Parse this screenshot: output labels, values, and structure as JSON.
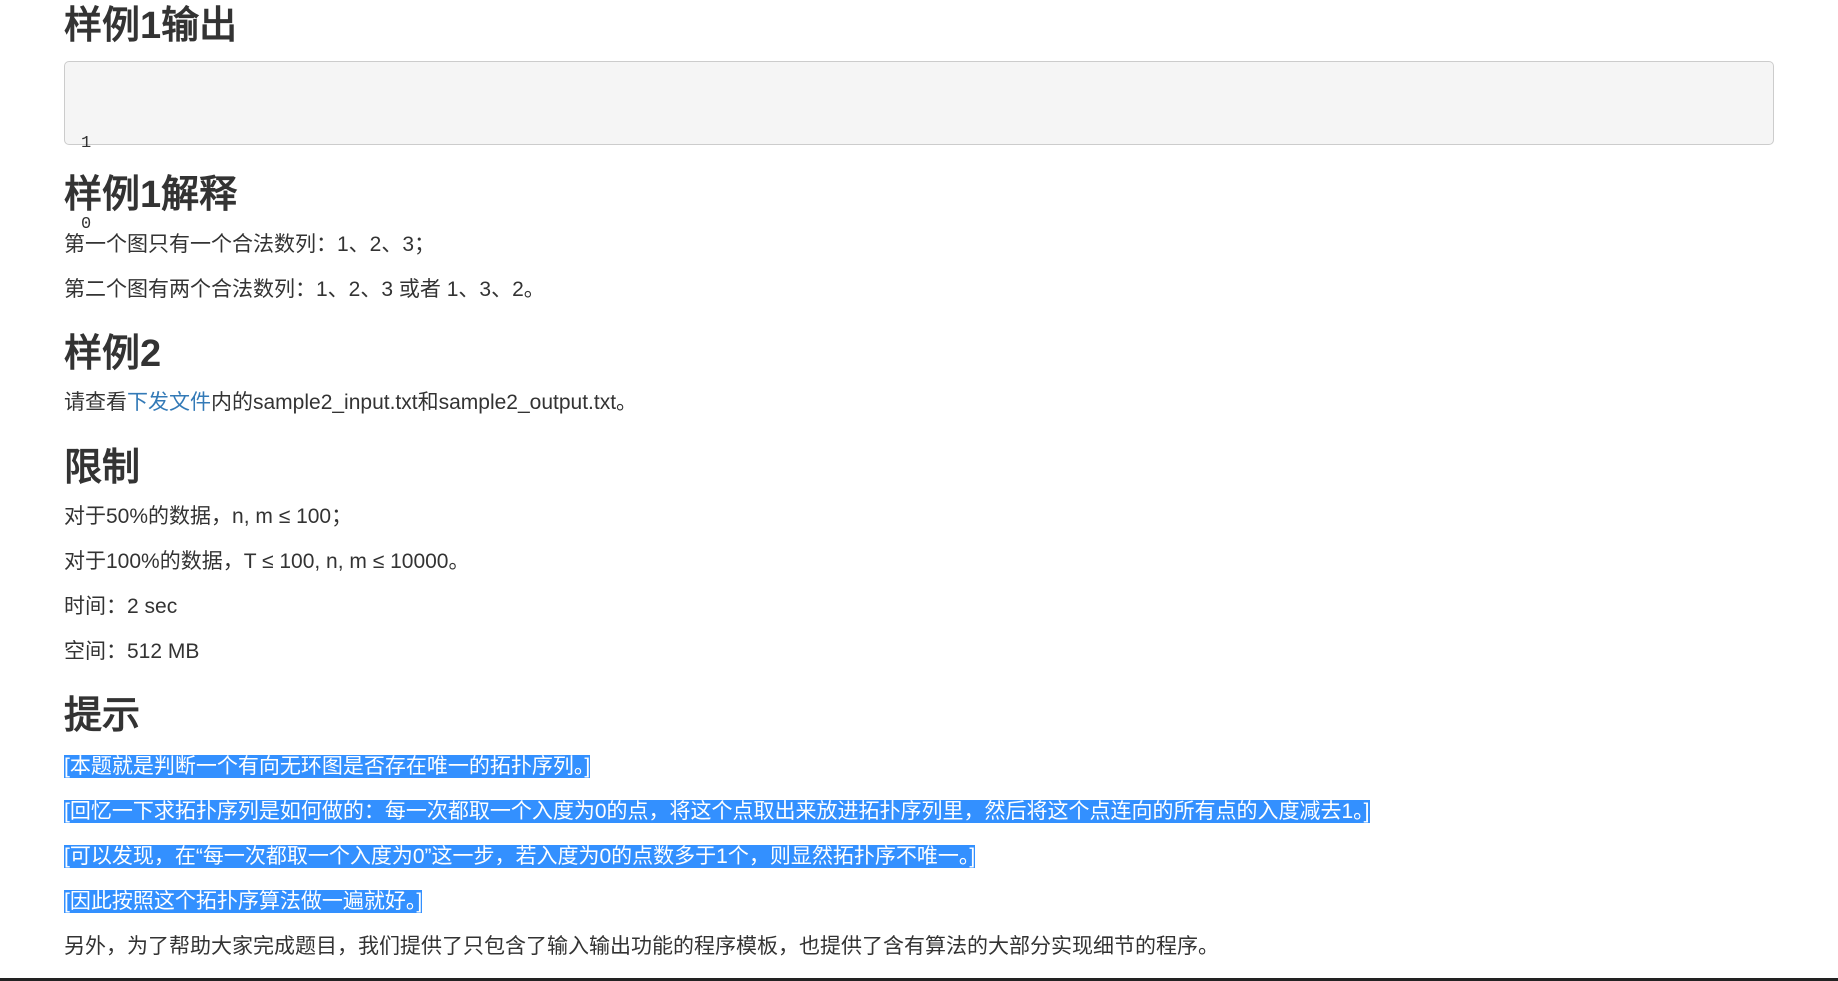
{
  "sample1_output": {
    "title": "样例1输出",
    "lines": [
      "1",
      "0"
    ]
  },
  "sample1_explain": {
    "title": "样例1解释",
    "para1": "第一个图只有一个合法数列：1、2、3；",
    "para2": "第二个图有两个合法数列：1、2、3 或者 1、3、2。"
  },
  "sample2": {
    "title": "样例2",
    "prefix": "请查看",
    "link_text": "下发文件",
    "suffix": "内的sample2_input.txt和sample2_output.txt。"
  },
  "limits": {
    "title": "限制",
    "para1": "对于50%的数据，n, m ≤ 100；",
    "para2": "对于100%的数据，T ≤ 100, n, m ≤ 10000。",
    "time": "时间：2 sec",
    "space": "空间：512 MB"
  },
  "hint": {
    "title": "提示",
    "line1": "[本题就是判断一个有向无环图是否存在唯一的拓扑序列。]",
    "line2": "[回忆一下求拓扑序列是如何做的：每一次都取一个入度为0的点，将这个点取出来放进拓扑序列里，然后将这个点连向的所有点的入度减去1。]",
    "line3": "[可以发现，在“每一次都取一个入度为0”这一步，若入度为0的点数多于1个，则显然拓扑序不唯一。]",
    "line4": "[因此按照这个拓扑序算法做一遍就好。]",
    "footer": "另外，为了帮助大家完成题目，我们提供了只包含了输入输出功能的程序模板，也提供了含有算法的大部分实现细节的程序。"
  },
  "colors": {
    "link": "#337ab7",
    "selection": "#3390ff",
    "text": "#333333",
    "code_bg": "#f5f5f5"
  }
}
